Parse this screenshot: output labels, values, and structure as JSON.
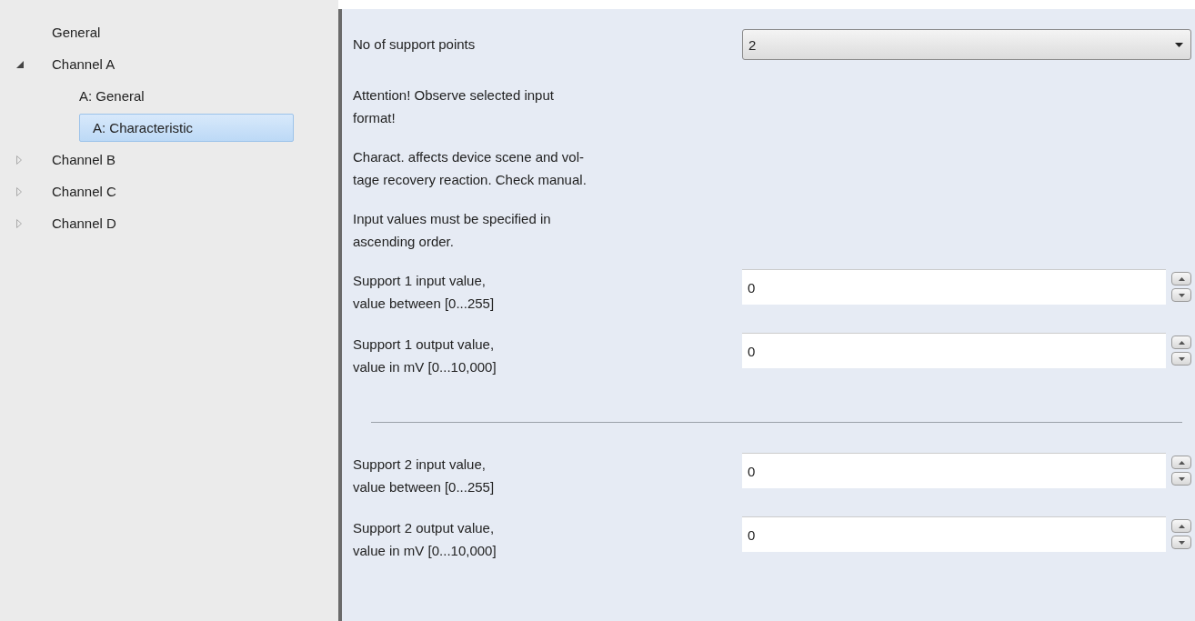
{
  "tree": [
    {
      "label": "General",
      "selected": false
    },
    {
      "label": "Channel A",
      "expanded": true,
      "selected": false,
      "children": [
        {
          "label": "A: General",
          "selected": false
        },
        {
          "label": "A: Characteristic",
          "selected": true
        }
      ]
    },
    {
      "label": "Channel B",
      "expanded": false,
      "selected": false
    },
    {
      "label": "Channel C",
      "expanded": false,
      "selected": false
    },
    {
      "label": "Channel D",
      "expanded": false,
      "selected": false
    }
  ],
  "parameters": [
    {
      "kind": "dropdown",
      "label": "No of support points",
      "value": "2"
    },
    {
      "kind": "note",
      "text": "Attention! Observe selected input\nformat!"
    },
    {
      "kind": "note",
      "text": "Charact. affects device scene and vol-\ntage recovery reaction. Check manual."
    },
    {
      "kind": "note",
      "text": "Input values must be specified in\nascending order."
    },
    {
      "kind": "spin",
      "label": "Support 1 input value,\nvalue between [0...255]",
      "value": "0"
    },
    {
      "kind": "spin",
      "label": "Support 1 output value,\nvalue in mV [0...10,000]",
      "value": "0"
    },
    {
      "kind": "separator"
    },
    {
      "kind": "spin",
      "label": "Support 2 input value,\nvalue between [0...255]",
      "value": "0"
    },
    {
      "kind": "spin",
      "label": "Support 2 output value,\nvalue in mV [0...10,000]",
      "value": "0"
    }
  ]
}
